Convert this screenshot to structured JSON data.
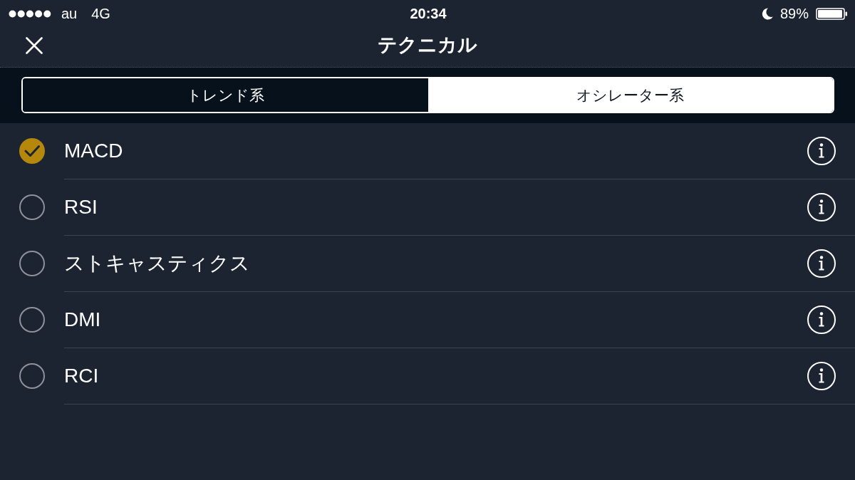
{
  "status_bar": {
    "carrier": "au",
    "network": "4G",
    "time": "20:34",
    "battery": "89%"
  },
  "nav": {
    "title": "テクニカル"
  },
  "segments": [
    {
      "label": "トレンド系",
      "selected": false
    },
    {
      "label": "オシレーター系",
      "selected": true
    }
  ],
  "indicators": [
    {
      "name": "MACD",
      "checked": true
    },
    {
      "name": "RSI",
      "checked": false
    },
    {
      "name": "ストキャスティクス",
      "checked": false
    },
    {
      "name": "DMI",
      "checked": false
    },
    {
      "name": "RCI",
      "checked": false
    }
  ]
}
